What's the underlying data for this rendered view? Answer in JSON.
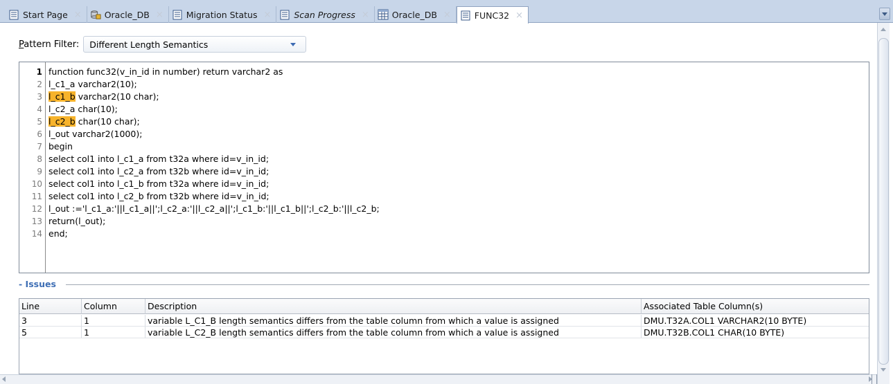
{
  "tabs": [
    {
      "label": "Start Page",
      "icon": "document-icon"
    },
    {
      "label": "Oracle_DB",
      "icon": "database-connection-icon"
    },
    {
      "label": "Migration Status",
      "icon": "document-icon"
    },
    {
      "label": "Scan Progress",
      "icon": "document-icon"
    },
    {
      "label": "Oracle_DB",
      "icon": "table-grid-icon"
    },
    {
      "label": "FUNC32",
      "icon": "document-icon"
    }
  ],
  "tab_close": "×",
  "filter": {
    "label_mnemonic": "P",
    "label_rest": "attern Filter:",
    "value": "Different Length Semantics"
  },
  "code": {
    "line_numbers": [
      "1",
      "2",
      "3",
      "4",
      "5",
      "6",
      "7",
      "8",
      "9",
      "10",
      "11",
      "12",
      "13",
      "14"
    ],
    "lines": [
      {
        "pre": "function func32(v_in_id in number) return varchar2 as",
        "hl": "",
        "post": ""
      },
      {
        "pre": "l_c1_a varchar2(10);",
        "hl": "",
        "post": ""
      },
      {
        "pre": "",
        "hl": "l_c1_b",
        "post": " varchar2(10 char);"
      },
      {
        "pre": "l_c2_a char(10);",
        "hl": "",
        "post": ""
      },
      {
        "pre": "",
        "hl": "l_c2_b",
        "post": " char(10 char);"
      },
      {
        "pre": "l_out varchar2(1000);",
        "hl": "",
        "post": ""
      },
      {
        "pre": "begin",
        "hl": "",
        "post": ""
      },
      {
        "pre": "select col1 into l_c1_a from t32a where id=v_in_id;",
        "hl": "",
        "post": ""
      },
      {
        "pre": "select col1 into l_c2_a from t32b where id=v_in_id;",
        "hl": "",
        "post": ""
      },
      {
        "pre": "select col1 into l_c1_b from t32a where id=v_in_id;",
        "hl": "",
        "post": ""
      },
      {
        "pre": "select col1 into l_c2_b from t32b where id=v_in_id;",
        "hl": "",
        "post": ""
      },
      {
        "pre": "l_out :='l_c1_a:'||l_c1_a||';l_c2_a:'||l_c2_a||';l_c1_b:'||l_c1_b||';l_c2_b:'||l_c2_b;",
        "hl": "",
        "post": ""
      },
      {
        "pre": "return(l_out);",
        "hl": "",
        "post": ""
      },
      {
        "pre": "end;",
        "hl": "",
        "post": ""
      }
    ],
    "highlight_color": "#f7b32b"
  },
  "issues": {
    "title": "Issues",
    "columns": [
      "Line",
      "Column",
      "Description",
      "Associated Table Column(s)"
    ],
    "rows": [
      [
        "3",
        "1",
        "variable L_C1_B length semantics differs from the table column from which a value is assigned",
        "DMU.T32A.COL1 VARCHAR2(10 BYTE)"
      ],
      [
        "5",
        "1",
        "variable L_C2_B length semantics differs from the table column from which a value is assigned",
        "DMU.T32B.COL1 CHAR(10 BYTE)"
      ]
    ]
  },
  "colors": {
    "tab_strip": "#c8d6e9",
    "section_title": "#3f6fb5"
  }
}
